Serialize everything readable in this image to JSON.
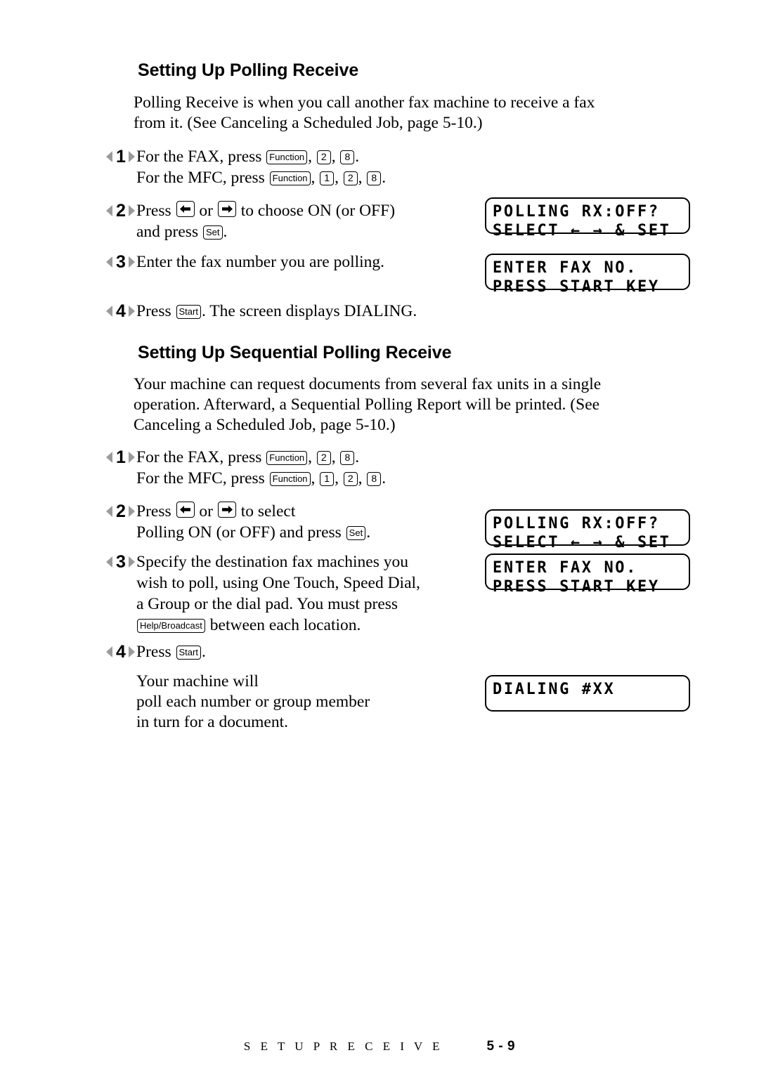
{
  "document": {
    "page_label": "5 - 9",
    "footer_title": "S E T U P   R E C E I V E"
  },
  "sections": [
    {
      "heading": "Setting Up Polling Receive",
      "intro_line1": "Polling Receive is when you call another fax machine to receive a fax",
      "intro_line2": "from it. (See Canceling a Scheduled Job, page 5-10.)",
      "steps": [
        {
          "number": "1",
          "line1_pre": "For the FAX, press ",
          "line1_keys": [
            "Function",
            "2",
            "8"
          ],
          "line1_post": ".",
          "line2_pre": "For the MFC, press ",
          "line2_keys": [
            "Function",
            "1",
            "2",
            "8"
          ],
          "line2_post": "."
        },
        {
          "number": "2",
          "line1_pre": "Press ",
          "line1_mid": " or ",
          "line1_post": " to choose ON (or OFF)",
          "line2_pre": "and press ",
          "line2_key": "Set",
          "line2_post": "."
        },
        {
          "number": "3",
          "line1": "Enter the fax number you are polling."
        },
        {
          "number": "4",
          "line1_pre": "Press ",
          "line1_key": "Start",
          "line1_post": ". The screen displays DIALING."
        }
      ]
    },
    {
      "heading": "Setting Up Sequential Polling Receive",
      "intro_line1": "Your machine can request documents from several fax units in a single",
      "intro_line2": "operation. Afterward, a Sequential Polling Report will be printed. (See",
      "intro_line3": "Canceling a Scheduled Job, page 5-10.)",
      "steps": [
        {
          "number": "1",
          "line1_pre": "For the FAX, press ",
          "line1_keys": [
            "Function",
            "2",
            "8"
          ],
          "line1_post": ".",
          "line2_pre": "For the MFC, press ",
          "line2_keys": [
            "Function",
            "1",
            "2",
            "8"
          ],
          "line2_post": "."
        },
        {
          "number": "2",
          "line1_pre": "Press ",
          "line1_mid": " or ",
          "line1_post": " to select",
          "line2_pre": "Polling ON (or OFF) and press ",
          "line2_key": "Set",
          "line2_post": "."
        },
        {
          "number": "3",
          "line1": "Specify the destination fax machines you",
          "line2": "wish to poll, using One Touch, Speed Dial,",
          "line3": "a Group or the dial pad.  You must press",
          "line4_key": "Help/Broadcast",
          "line4_post": " between each location."
        },
        {
          "number": "4",
          "line1_pre": "Press ",
          "line1_key": "Start",
          "line1_post": ".",
          "extra_line1": "Your machine will",
          "extra_line2": "poll each number or group member",
          "extra_line3": "in turn for a document."
        }
      ]
    }
  ],
  "lcd_displays": [
    {
      "id": "polling-rx-1",
      "line1": "POLLING RX:OFF?",
      "line2": "SELECT ← → & SET"
    },
    {
      "id": "enter-fax-no-1",
      "line1": "ENTER FAX NO.",
      "line2": "PRESS START KEY"
    },
    {
      "id": "polling-rx-2",
      "line1": "POLLING RX:OFF?",
      "line2": "SELECT ← → & SET"
    },
    {
      "id": "enter-fax-no-2",
      "line1": "ENTER FAX NO.",
      "line2": "PRESS START KEY"
    },
    {
      "id": "dialing",
      "line1": "DIALING #XX",
      "line2": ""
    }
  ],
  "icons": {
    "left_arrow_key": "arrow-left-key-icon",
    "right_arrow_key": "arrow-right-key-icon",
    "step_marker": "step-marker-triangle-icon"
  }
}
